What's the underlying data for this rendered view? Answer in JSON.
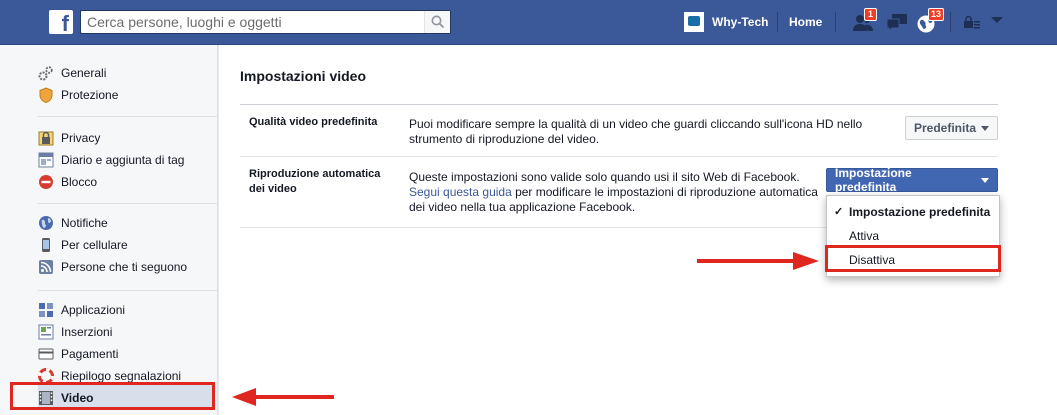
{
  "topbar": {
    "logo": "f",
    "search_placeholder": "Cerca persone, luoghi e oggetti",
    "profile_name": "Why-Tech",
    "home_label": "Home",
    "friend_requests_count": "1",
    "notifications_count": "13",
    "icons": [
      "facebook-logo-icon",
      "search-icon",
      "friends-icon",
      "messages-icon",
      "globe-icon",
      "privacy-shortcuts-icon",
      "chevron-down-icon"
    ]
  },
  "sidebar": {
    "groups": [
      [
        {
          "label": "Generali",
          "icon": "gears-icon"
        },
        {
          "label": "Protezione",
          "icon": "shield-icon"
        }
      ],
      [
        {
          "label": "Privacy",
          "icon": "lock-icon"
        },
        {
          "label": "Diario e aggiunta di tag",
          "icon": "timeline-icon"
        },
        {
          "label": "Blocco",
          "icon": "block-icon"
        }
      ],
      [
        {
          "label": "Notifiche",
          "icon": "globe-icon"
        },
        {
          "label": "Per cellulare",
          "icon": "mobile-icon"
        },
        {
          "label": "Persone che ti seguono",
          "icon": "rss-icon"
        }
      ],
      [
        {
          "label": "Applicazioni",
          "icon": "apps-icon"
        },
        {
          "label": "Inserzioni",
          "icon": "ads-icon"
        },
        {
          "label": "Pagamenti",
          "icon": "card-icon"
        },
        {
          "label": "Riepilogo segnalazioni",
          "icon": "lifebuoy-icon"
        },
        {
          "label": "Video",
          "icon": "film-icon",
          "selected": true
        }
      ]
    ]
  },
  "main": {
    "title": "Impostazioni video",
    "settings": [
      {
        "label": "Qualità video predefinita",
        "description": "Puoi modificare sempre la qualità di un video che guardi cliccando sull'icona HD nello strumento di riproduzione del video.",
        "button": "Predefinita"
      },
      {
        "label": "Riproduzione automatica dei video",
        "description_line1": "Queste impostazioni sono valide solo quando usi il sito Web di Facebook.",
        "link_text": "Segui questa guida",
        "description_rest": " per modificare le impostazioni di riproduzione automatica dei video nella tua applicazione Facebook.",
        "button": "Impostazione predefinita"
      }
    ],
    "dropdown": {
      "options": [
        "Impostazione predefinita",
        "Attiva",
        "Disattiva"
      ],
      "selected": "Impostazione predefinita"
    }
  },
  "colors": {
    "topbar": "#3b5998",
    "primary_button": "#4267b2",
    "annotation_red": "#e0271f"
  }
}
